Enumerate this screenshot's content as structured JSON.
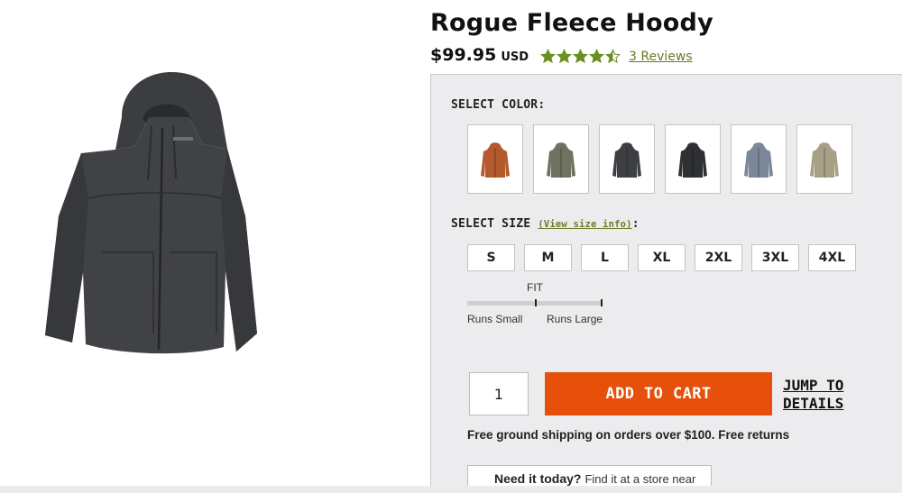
{
  "product": {
    "title": "Rogue Fleece Hoody",
    "price": "$99.95",
    "currency": "USD",
    "rating": 4.5,
    "rating_max": 5,
    "reviews_link": "3 Reviews",
    "image_icon": "hoodie-product-image"
  },
  "colors": {
    "label": "SELECT COLOR:",
    "swatches": [
      {
        "name": "orange",
        "hex": "#b45a2c"
      },
      {
        "name": "olive",
        "hex": "#6f7260"
      },
      {
        "name": "charcoal",
        "hex": "#3d3f42"
      },
      {
        "name": "black",
        "hex": "#2e3033"
      },
      {
        "name": "slate-blue",
        "hex": "#7b8899"
      },
      {
        "name": "tan",
        "hex": "#a89f87"
      }
    ]
  },
  "sizes": {
    "label": "SELECT SIZE",
    "size_info_link": "(View size info)",
    "label_suffix": ":",
    "options": [
      "S",
      "M",
      "L",
      "XL",
      "2XL",
      "3XL",
      "4XL"
    ]
  },
  "fit": {
    "label": "FIT",
    "runs_small": "Runs Small",
    "runs_large": "Runs Large"
  },
  "cart": {
    "quantity": "1",
    "add_to_cart": "ADD TO CART",
    "jump_to_details": "JUMP TO DETAILS"
  },
  "shipping": {
    "text": "Free ground shipping on orders over $100.  Free returns"
  },
  "store": {
    "strong": "Need it today?",
    "light": "Find it at a store near"
  },
  "colors_theme": {
    "accent_orange": "#e7500a",
    "star_green": "#6b8e23",
    "link_green": "#6b7a26",
    "panel_bg": "#ececee"
  }
}
